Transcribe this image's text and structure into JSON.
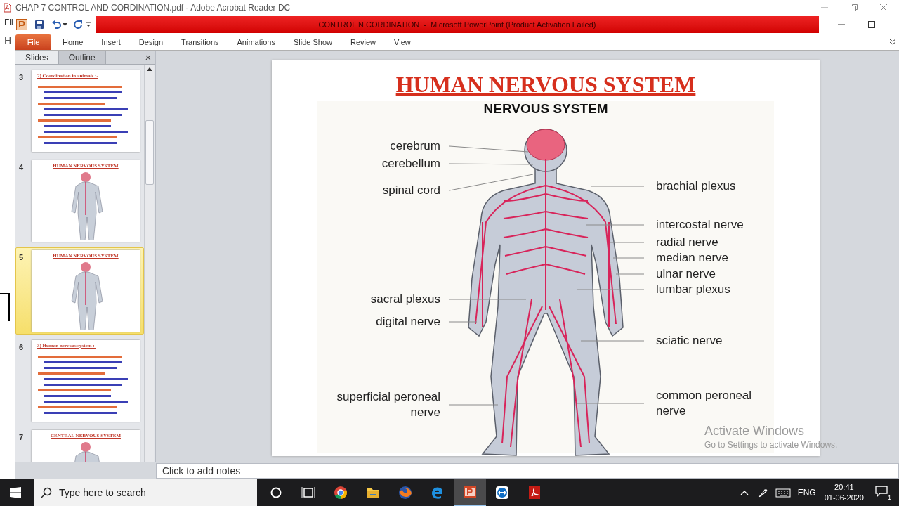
{
  "acrobat": {
    "title": "CHAP 7 CONTROL AND CORDINATION.pdf - Adobe Acrobat Reader DC",
    "menu_fragment": "Fil",
    "toolbar_fragment": "H"
  },
  "powerpoint": {
    "title": "CONTROL N CORDINATION  -  Microsoft PowerPoint (Product Activation Failed)",
    "ribbon_tabs": [
      {
        "label": "File",
        "kind": "file",
        "selected": false
      },
      {
        "label": "Home",
        "kind": "tab",
        "selected": false
      },
      {
        "label": "Insert",
        "kind": "tab",
        "selected": false
      },
      {
        "label": "Design",
        "kind": "tab",
        "selected": false
      },
      {
        "label": "Transitions",
        "kind": "tab",
        "selected": false
      },
      {
        "label": "Animations",
        "kind": "tab",
        "selected": false
      },
      {
        "label": "Slide Show",
        "kind": "tab",
        "selected": false
      },
      {
        "label": "Review",
        "kind": "tab",
        "selected": false
      },
      {
        "label": "View",
        "kind": "tab",
        "selected": false
      }
    ],
    "panel_tabs": [
      {
        "label": "Slides",
        "selected": true
      },
      {
        "label": "Outline",
        "selected": false
      }
    ],
    "close_glyph": "×",
    "thumbnails": [
      {
        "number": "3",
        "title": "2) Coordination in animals :-",
        "kind": "text",
        "selected": false
      },
      {
        "number": "4",
        "title": "HUMAN NERVOUS SYSTEM",
        "kind": "figure",
        "selected": false
      },
      {
        "number": "5",
        "title": "HUMAN NERVOUS SYSTEM",
        "kind": "figure",
        "selected": true
      },
      {
        "number": "6",
        "title": "3) Human nervous system :-",
        "kind": "text",
        "selected": false
      },
      {
        "number": "7",
        "title": "CENTRAL NERVOUS SYSTEM",
        "kind": "figure",
        "selected": false
      }
    ],
    "slide": {
      "title": "HUMAN NERVOUS SYSTEM",
      "subtitle": "NERVOUS SYSTEM",
      "left_labels": [
        "cerebrum",
        "cerebellum",
        "spinal cord",
        "sacral plexus",
        "digital nerve",
        "superficial peroneal nerve"
      ],
      "right_labels": [
        "brachial plexus",
        "intercostal nerve",
        "radial nerve",
        "median nerve",
        "ulnar nerve",
        "lumbar plexus",
        "sciatic nerve",
        "common peroneal nerve"
      ]
    },
    "notes": {
      "placeholder": "Click to add notes"
    }
  },
  "activation": {
    "title": "Activate Windows",
    "hint": "Go to Settings to activate Windows."
  },
  "taskbar": {
    "search": {
      "placeholder": "Type here to search"
    },
    "apps": [
      {
        "kind": "cortana",
        "active": false
      },
      {
        "kind": "taskview",
        "active": false
      },
      {
        "kind": "chrome",
        "active": false
      },
      {
        "kind": "explorer",
        "active": false
      },
      {
        "kind": "firefox",
        "active": false
      },
      {
        "kind": "edge",
        "active": false
      },
      {
        "kind": "powerpoint",
        "active": true
      },
      {
        "kind": "teamviewer",
        "active": false
      },
      {
        "kind": "acrobat",
        "active": false
      }
    ],
    "language": "ENG",
    "time": "20:41",
    "date": "01-06-2020",
    "notifications": "1"
  }
}
